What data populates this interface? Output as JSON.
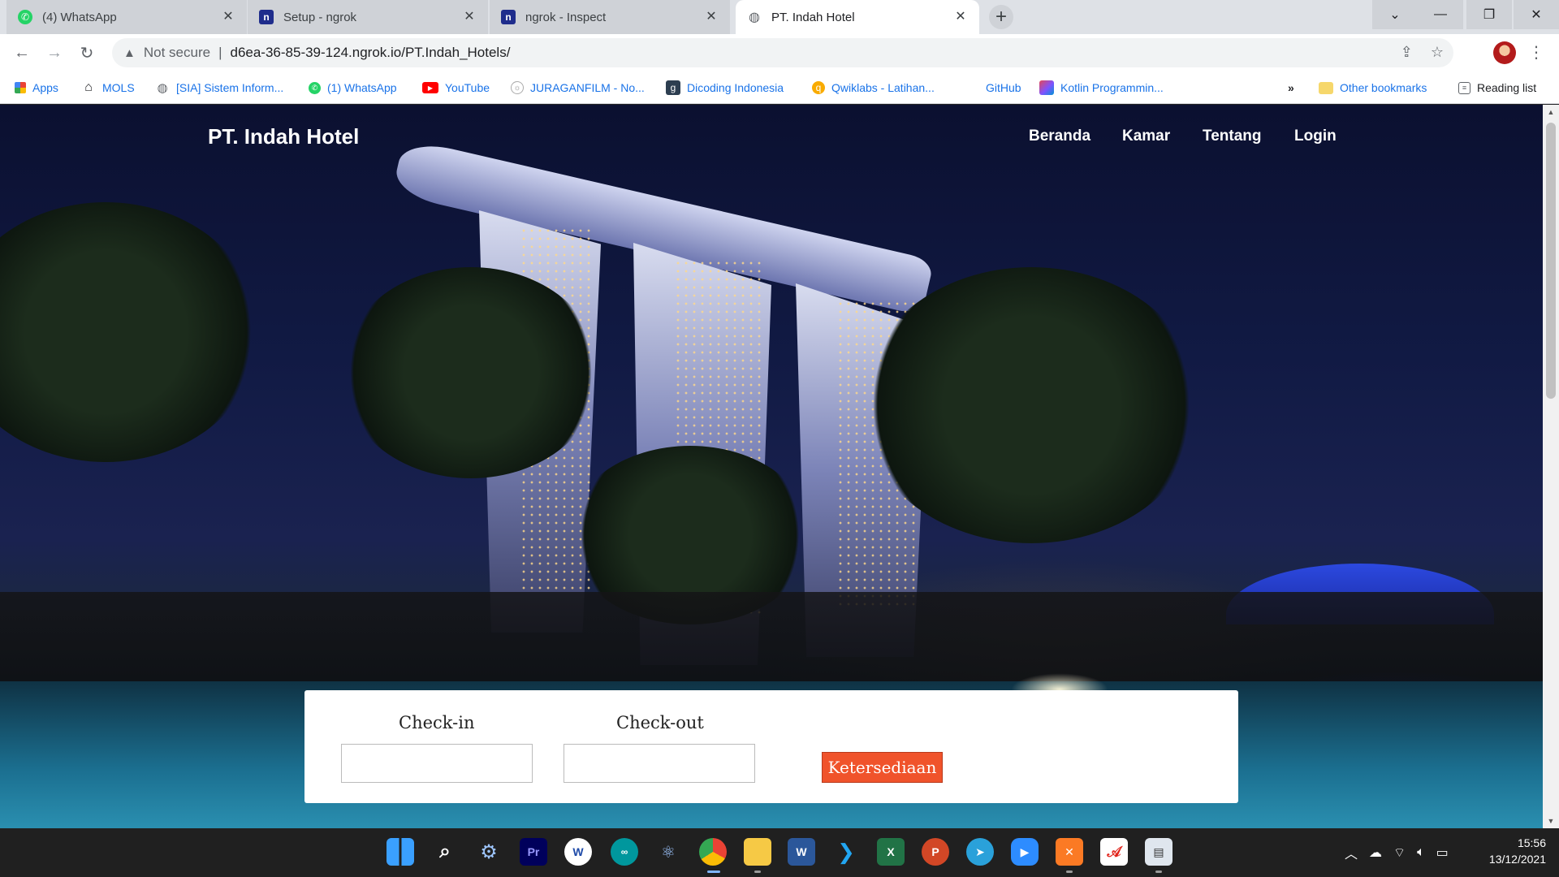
{
  "browser": {
    "tabs": [
      {
        "title": "(4) WhatsApp",
        "icon": "whatsapp-icon",
        "active": false
      },
      {
        "title": "Setup - ngrok",
        "icon": "ngrok-icon",
        "active": false
      },
      {
        "title": "ngrok - Inspect",
        "icon": "ngrok-icon",
        "active": false
      },
      {
        "title": "PT. Indah Hotel",
        "icon": "globe-icon",
        "active": true
      }
    ],
    "security_label": "Not secure",
    "url": "d6ea-36-85-39-124.ngrok.io/PT.Indah_Hotels/",
    "bookmarks": [
      {
        "label": "Apps",
        "icon": "apps-grid-icon"
      },
      {
        "label": "MOLS",
        "icon": "home-icon"
      },
      {
        "label": "[SIA] Sistem Inform...",
        "icon": "globe-icon"
      },
      {
        "label": "(1) WhatsApp",
        "icon": "whatsapp-icon"
      },
      {
        "label": "YouTube",
        "icon": "youtube-icon"
      },
      {
        "label": "JURAGANFILM - No...",
        "icon": "juraganfilm-icon"
      },
      {
        "label": "Dicoding Indonesia",
        "icon": "dicoding-icon"
      },
      {
        "label": "Qwiklabs - Latihan...",
        "icon": "qwiklabs-icon"
      },
      {
        "label": "GitHub",
        "icon": "github-icon"
      },
      {
        "label": "Kotlin Programmin...",
        "icon": "kotlin-icon"
      }
    ],
    "more_bookmarks": "»",
    "other_bookmarks": "Other bookmarks",
    "reading_list": "Reading list"
  },
  "site": {
    "brand": "PT. Indah Hotel",
    "nav": [
      "Beranda",
      "Kamar",
      "Tentang",
      "Login"
    ],
    "booking": {
      "checkin_label": "Check-in",
      "checkout_label": "Check-out",
      "checkin_value": "",
      "checkout_value": "",
      "submit_label": "Ketersediaan"
    }
  },
  "taskbar": {
    "clock_time": "15:56",
    "clock_date": "13/12/2021",
    "apps": [
      "windows-start-icon",
      "search-icon",
      "settings-icon",
      "premiere-icon",
      "whatsapp-desktop-icon",
      "arduino-icon",
      "network-icon",
      "chrome-icon",
      "file-explorer-icon",
      "word-icon",
      "vscode-icon",
      "excel-icon",
      "powerpoint-icon",
      "telegram-icon",
      "zoom-icon",
      "xampp-icon",
      "acrobat-icon",
      "notepad-icon"
    ]
  },
  "colors": {
    "accent_button": "#f0532b",
    "link_blue": "#1a73e8",
    "taskbar": "#202020"
  }
}
